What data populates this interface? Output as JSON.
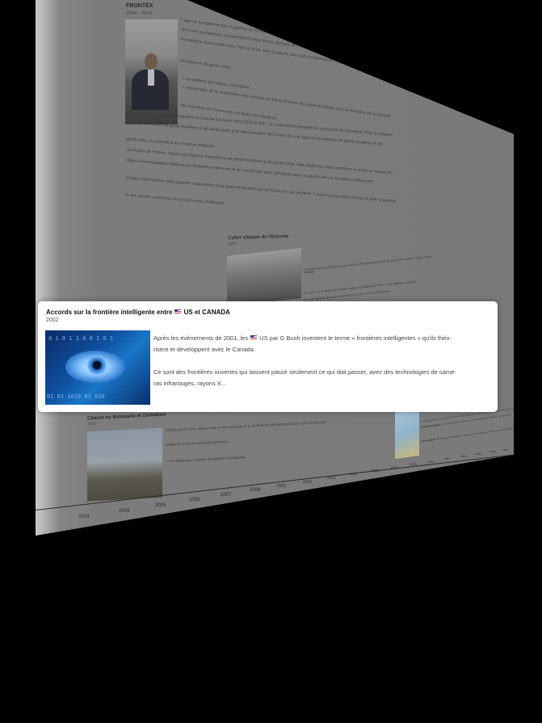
{
  "event_card": {
    "title_prefix": "Accords sur la frontière intelligente entre",
    "title_suffix": "US et CANADA",
    "year": "2002",
    "line1_prefix": "Après les évènements de 2001, les",
    "line1_suffix": "US par G Bush inventent le terme « frontières intelligentes » qu'ils théo-",
    "line2": "risent et développent avec le Canada.",
    "line3": "Ce sont des frontières ouvertes qui laissent passé seulement ce qui doit passer, avec des technologies de camé-",
    "line4": "ras infrarouges, rayons X...",
    "image_icon": "cyber-eye-image"
  },
  "background_entries": {
    "frontex": {
      "title": "FRONTEX",
      "years": "2004 - 2016",
      "lines": [
        "L'agence européenne pour la gestion de la coopération opérationnelle aux frontières extérieures des États membres",
        "de l'Union européenne, couramment Frontex (forme abrégée de « frontières extérieures »), est une agence de l'Union",
        "européenne ayant existé entre 2004 et 2016, date à laquelle elle a été remplacée par l'Agence européenne de garde-",
        "frontières et de garde-côtes.",
        "-> surveillance par bateau, helicoptère",
        "-> responsable de la coordination des activités de divers services des garde-frontières dans le domaine de la sécurité",
        "des frontières de l'Union avec les États non membres."
      ],
      "lines_bottom": [
        "Dans le contexte de la crise migratoire en Europe à l'œuvre entre 2015 et 2017, la Commission européenne a proposé en décembre 2015 la création",
        "d'un corps européen de garde-frontières et de garde-côtes et la transformation de Frontex en une agence européenne de garde-frontières et de",
        "garde-côtes, au mandat et aux moyens renforcés.",
        "La mission de Frontex, reprise par l'Agence européenne de garde-frontières et de garde-côtes, était d'aider les États membres à mettre en œuvre les",
        "règles communautaires relatives aux frontières extérieures et de coordonner leurs opérations dans la gestion de ces frontières extérieures.",
        "Chaque État membre reste toutefois responsable de la partie de frontière qui se trouve sur son territoire. L'Agence peut aussi institue et aider à garantir",
        "le des normes communes et un haut niveau d'efficacité."
      ]
    },
    "cyber": {
      "title": "Cyber attaque de l'Estonie",
      "year": "2007",
      "lines": [
        "L'Estonie est la première pays à avoir officiellement reconnu avoir été victime d'une cyber",
        "attaque.",
        "En 2007, une statue de Soldat rouge est déplacée. Par le rest l'affaire entraîne",
        "de tout officiels du gouvernement estonien et il y a plusieurs..."
      ]
    },
    "cloture": {
      "title": "Cloture au Botswana et Zimbabwe",
      "year": "2003",
      "lines": [
        "Construction d'une clôture entre le Mozambique et le Zimbabwe officiellement pour lutter contre une",
        "épidémie de fièvre aphteuse (animaux).",
        "-> en réalité pour stopper immigration clandestine"
      ]
    },
    "map_note": {
      "lines": [
        "Le Royaume-Uni se retire de l'Union européenne en votant en faveur du Brexit par référendum",
        "Pays tiers Regard: Ouverture des frontières et des échanges des biens, le Royaume",
        "Unis en tant pays...",
        "Les frontières de l'Espace Schengen et la sortie du Royaume-Uni de l'Union Européenne,",
        "prévue 2019..."
      ]
    }
  },
  "axis": {
    "years": [
      "2003",
      "2004",
      "2005",
      "2006",
      "2007",
      "2008",
      "2009",
      "2010",
      "2011",
      "2012",
      "2013",
      "2014",
      "2015",
      "2016",
      "2017",
      "2018",
      "2019",
      "2020",
      "2021"
    ]
  }
}
